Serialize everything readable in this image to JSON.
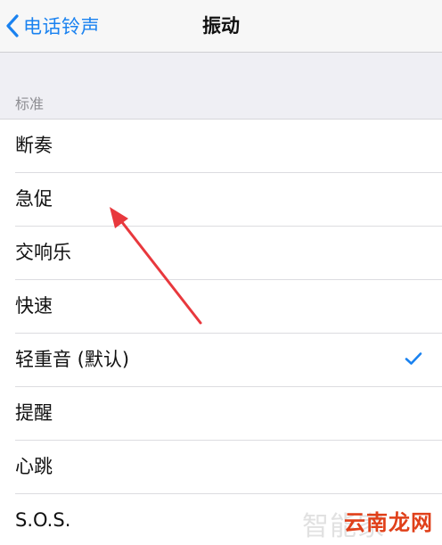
{
  "navbar": {
    "back_label": "电话铃声",
    "title": "振动"
  },
  "section": {
    "header": "标准"
  },
  "patterns": [
    {
      "label": "断奏",
      "selected": false
    },
    {
      "label": "急促",
      "selected": false
    },
    {
      "label": "交响乐",
      "selected": false
    },
    {
      "label": "快速",
      "selected": false
    },
    {
      "label": "轻重音 (默认)",
      "selected": true
    },
    {
      "label": "提醒",
      "selected": false
    },
    {
      "label": "心跳",
      "selected": false
    },
    {
      "label": "S.O.S.",
      "selected": false
    }
  ],
  "watermarks": {
    "faint": "智能家",
    "logo": "云南龙网"
  },
  "colors": {
    "accent": "#1a82f0",
    "arrow": "#e8383d",
    "logo": "#e0401a"
  }
}
